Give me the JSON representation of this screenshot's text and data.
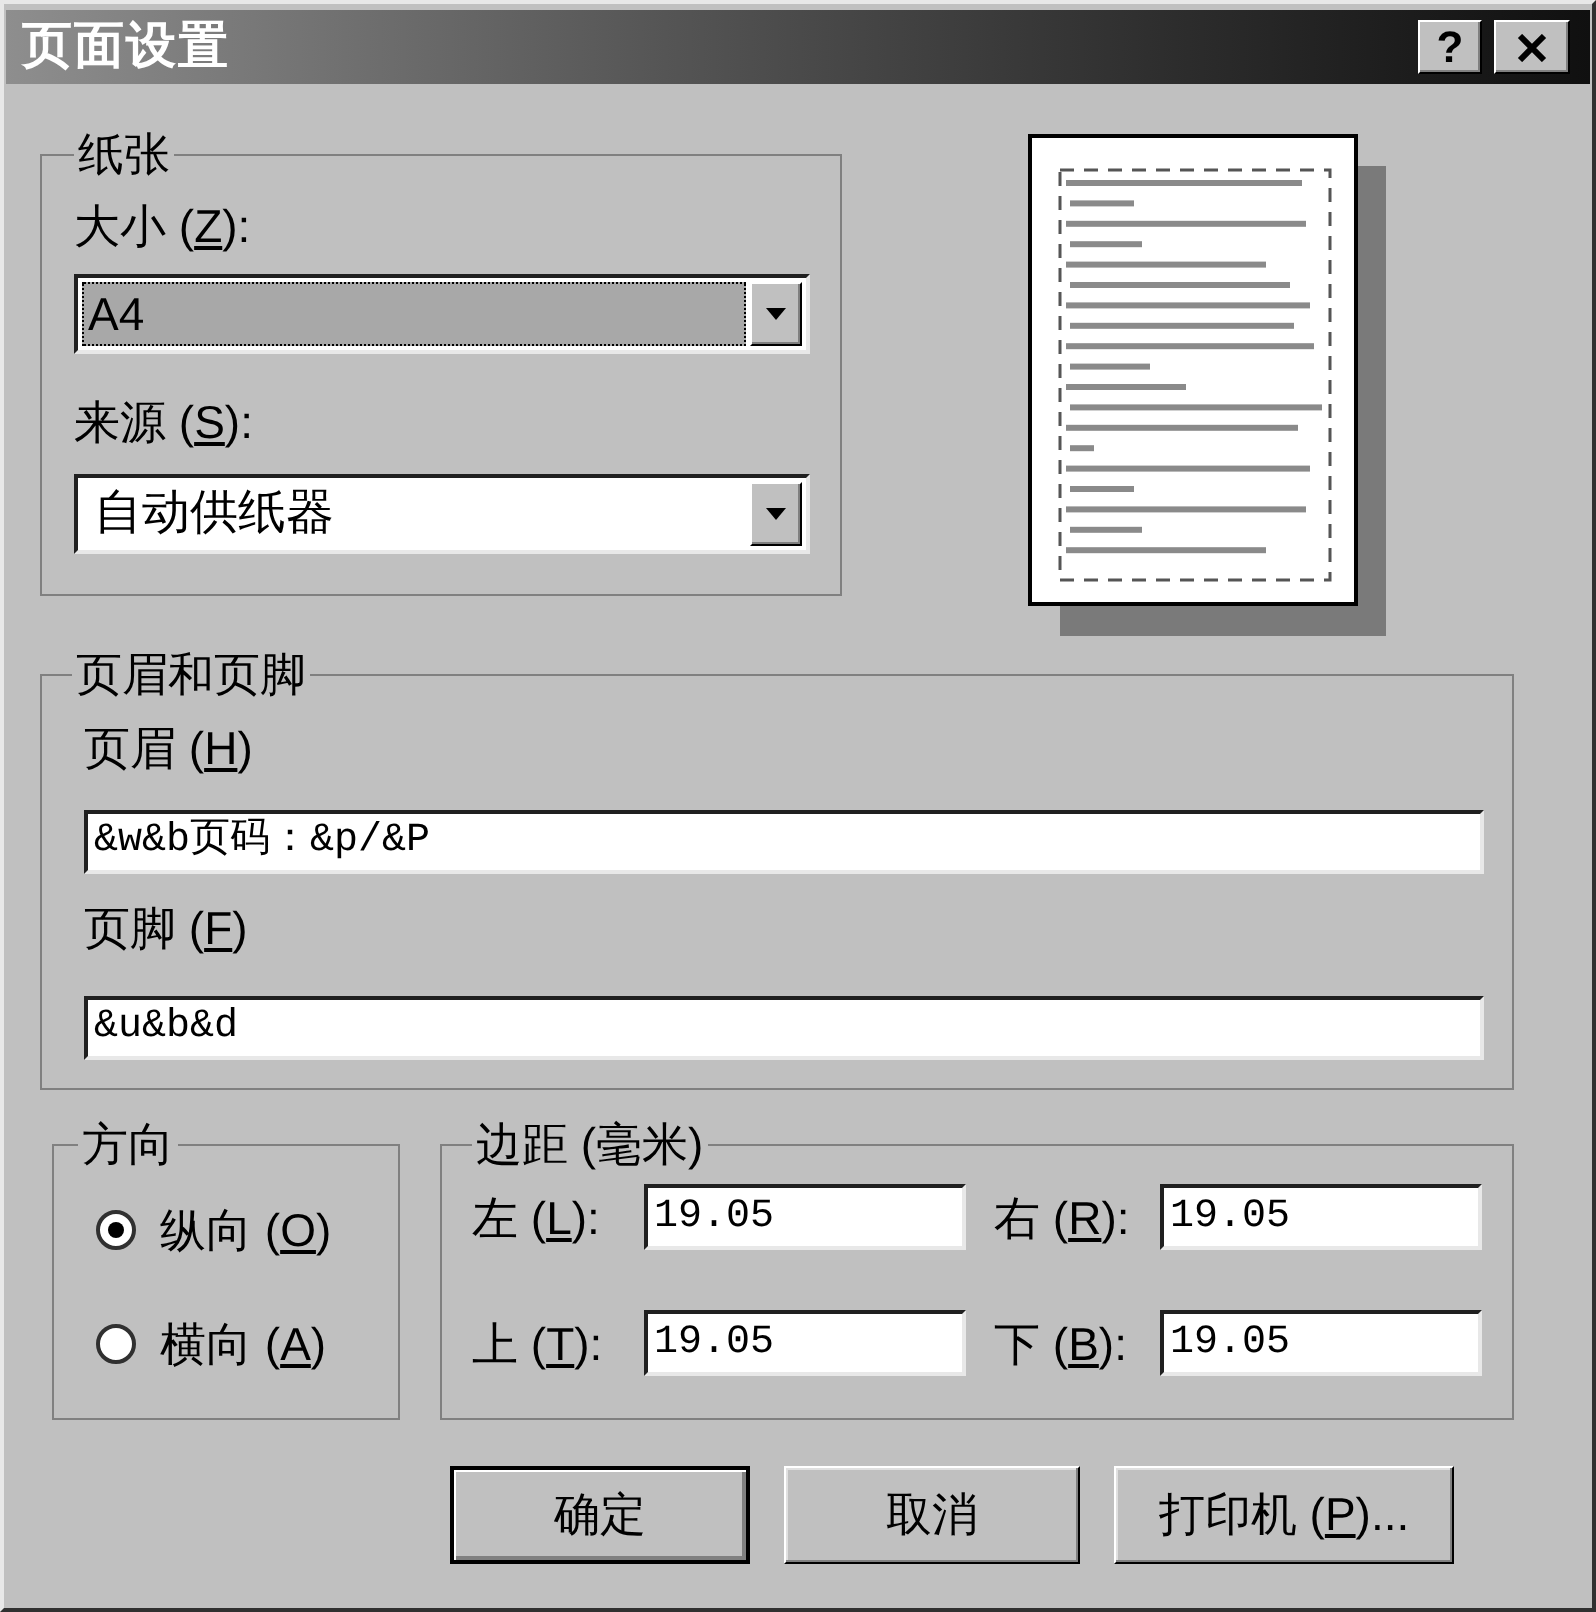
{
  "window": {
    "title": "页面设置",
    "help_button": "?"
  },
  "paper": {
    "title": "纸张",
    "size": {
      "label": {
        "text": "大小 (",
        "key": "Z",
        "text_after": "):"
      },
      "value": "A4",
      "focused": true
    },
    "source": {
      "label": {
        "text": "来源 (",
        "key": "S",
        "text_after": "):"
      },
      "value": "自动供纸器",
      "focused": false
    }
  },
  "header_footer": {
    "title": "页眉和页脚",
    "header": {
      "label": {
        "text": "页眉 (",
        "key": "H",
        "text_after": ")"
      },
      "value": "&w&b页码：&p/&P"
    },
    "footer": {
      "label": {
        "text": "页脚 (",
        "key": "F",
        "text_after": ")"
      },
      "value": "&u&b&d"
    }
  },
  "orientation": {
    "title": "方向",
    "options": [
      {
        "label": {
          "text": "纵向 (",
          "key": "O",
          "text_after": ")"
        },
        "selected": true
      },
      {
        "label": {
          "text": "横向 (",
          "key": "A",
          "text_after": ")"
        },
        "selected": false
      }
    ]
  },
  "margins": {
    "title": "边距 (毫米)",
    "fields": [
      {
        "label": {
          "text": "左 (",
          "key": "L",
          "text_after": "):"
        },
        "value": "19.05"
      },
      {
        "label": {
          "text": "右 (",
          "key": "R",
          "text_after": "):"
        },
        "value": "19.05"
      },
      {
        "label": {
          "text": "上 (",
          "key": "T",
          "text_after": "):"
        },
        "value": "19.05"
      },
      {
        "label": {
          "text": "下 (",
          "key": "B",
          "text_after": "):"
        },
        "value": "19.05"
      }
    ]
  },
  "buttons": [
    {
      "label": {
        "text": "确定"
      },
      "default": true
    },
    {
      "label": {
        "text": "取消"
      },
      "default": false
    },
    {
      "label": {
        "text": "打印机 (",
        "key": "P",
        "text_after": ")..."
      },
      "default": false
    }
  ]
}
